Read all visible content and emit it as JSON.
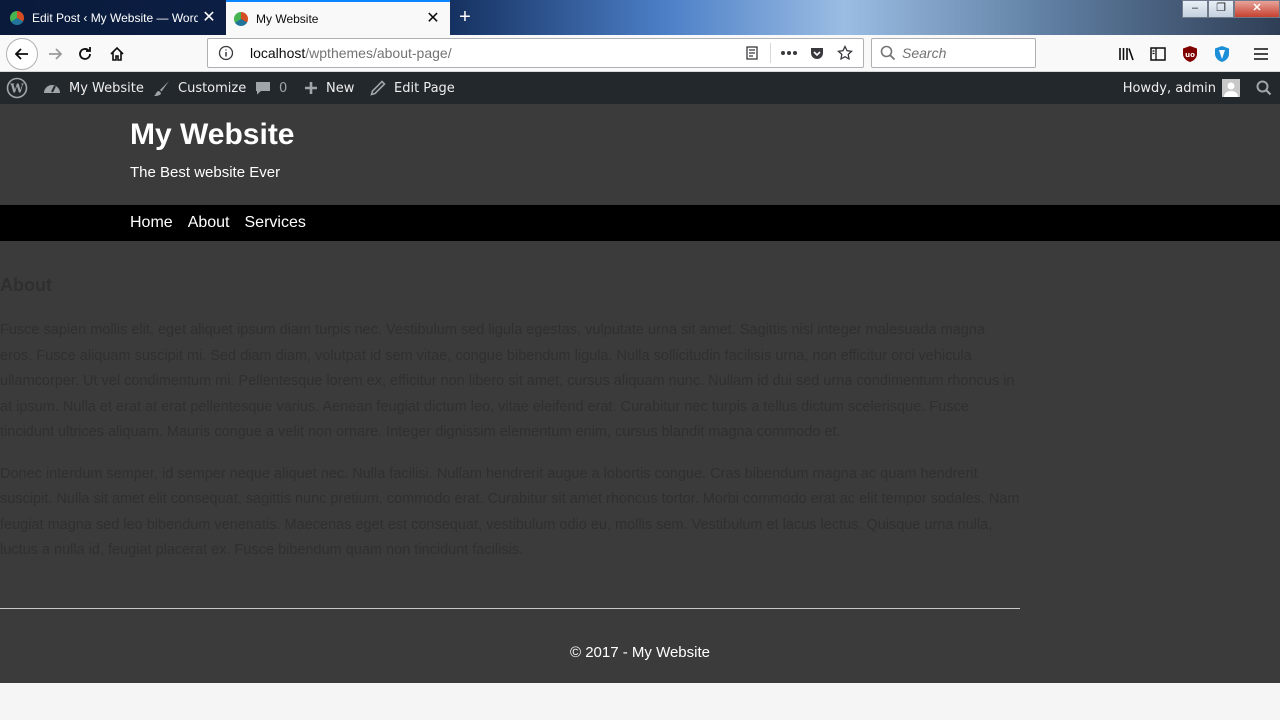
{
  "browser": {
    "tabs": [
      {
        "title": "Edit Post ‹ My Website — WordPress",
        "active": false
      },
      {
        "title": "My Website",
        "active": true
      }
    ],
    "new_tab_symbol": "+",
    "close_symbol": "✕",
    "window_controls": {
      "minimize": "–",
      "restore": "❐",
      "close": "✕"
    },
    "url": {
      "host": "localhost",
      "path": "/wpthemes/about-page/"
    },
    "search_placeholder": "Search",
    "accent_color": "#0a84ff"
  },
  "adminbar": {
    "site_name": "My Website",
    "customize": "Customize",
    "comments_count": "0",
    "new": "New",
    "edit_page": "Edit Page",
    "howdy": "Howdy, admin",
    "background": "#23282d"
  },
  "site": {
    "title": "My Website",
    "tagline": "The Best website Ever",
    "nav": [
      "Home",
      "About",
      "Services"
    ],
    "page_heading": "About",
    "paragraphs": [
      "Fusce sapien mollis elit, eget aliquet ipsum diam turpis nec. Vestibulum sed ligula egestas, vulputate urna sit amet. Sagittis nisl integer malesuada magna eros. Fusce aliquam suscipit mi. Sed diam diam, volutpat id sem vitae, congue bibendum ligula. Nulla sollicitudin facilisis urna, non efficitur orci vehicula ullamcorper. Ut vel condimentum mi. Pellentesque lorem ex, efficitur non libero sit amet, cursus aliquam nunc. Nullam id dui sed urna condimentum rhoncus in at ipsum. Nulla et erat at erat pellentesque varius. Aenean feugiat dictum leo, vitae eleifend erat. Curabitur nec turpis a tellus dictum scelerisque. Fusce tincidunt ultrices aliquam. Mauris congue a velit non ornare. Integer dignissim elementum enim, cursus blandit magna commodo et.",
      "Donec interdum semper, id semper neque aliquet nec. Nulla facilisi. Nullam hendrerit augue a lobortis congue. Cras bibendum magna ac quam hendrerit suscipit. Nulla sit amet elit consequat, sagittis nunc pretium, commodo erat. Curabitur sit amet rhoncus tortor. Morbi commodo erat ac elit tempor sodales. Nam feugiat magna sed leo bibendum venenatis. Maecenas eget est consequat, vestibulum odio eu, mollis sem. Vestibulum et lacus lectus. Quisque urna nulla, luctus a nulla id, feugiat placerat ex. Fusce bibendum quam non tincidunt facilisis."
    ],
    "footer": "© 2017 - My Website",
    "background": "#3b3b3b",
    "nav_background": "#000000"
  }
}
